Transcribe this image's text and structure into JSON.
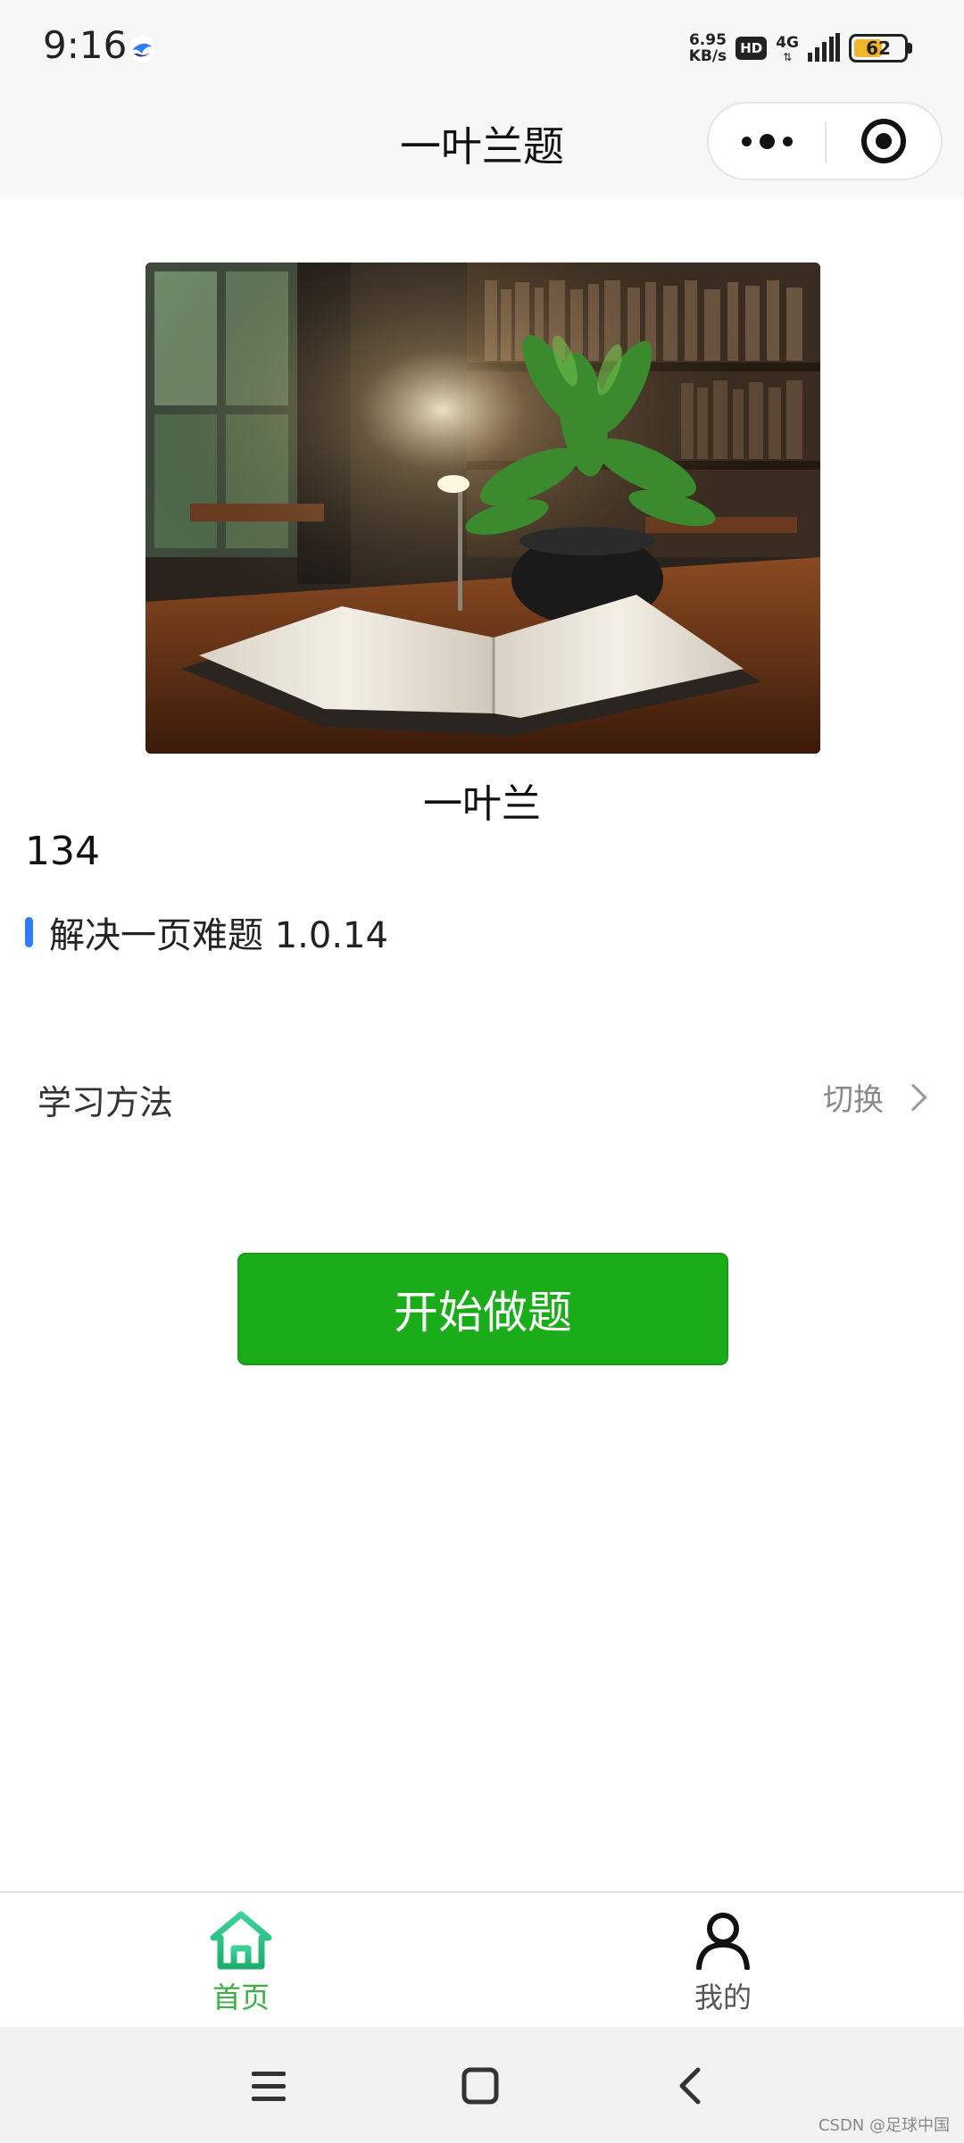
{
  "status_bar": {
    "time": "9:16",
    "net_speed_value": "6.95",
    "net_speed_unit": "KB/s",
    "hd_badge": "HD",
    "network": "4G",
    "battery_level": "62",
    "battery_fraction": 0.62
  },
  "nav": {
    "title": "一叶兰题"
  },
  "content": {
    "book_name": "一叶兰",
    "count": "134",
    "version_text": "解决一页难题 1.0.14",
    "method_label": "学习方法",
    "method_switch": "切换",
    "start_button": "开始做题"
  },
  "tabbar": {
    "items": [
      {
        "label": "首页",
        "icon": "home-icon",
        "active": true
      },
      {
        "label": "我的",
        "icon": "person-icon",
        "active": false
      }
    ],
    "active_color": "#3cb043"
  },
  "system_nav": {
    "watermark": "CSDN @足球中国"
  },
  "colors": {
    "primary_button": "#1aad19",
    "version_accent": "#2f7cf6"
  }
}
